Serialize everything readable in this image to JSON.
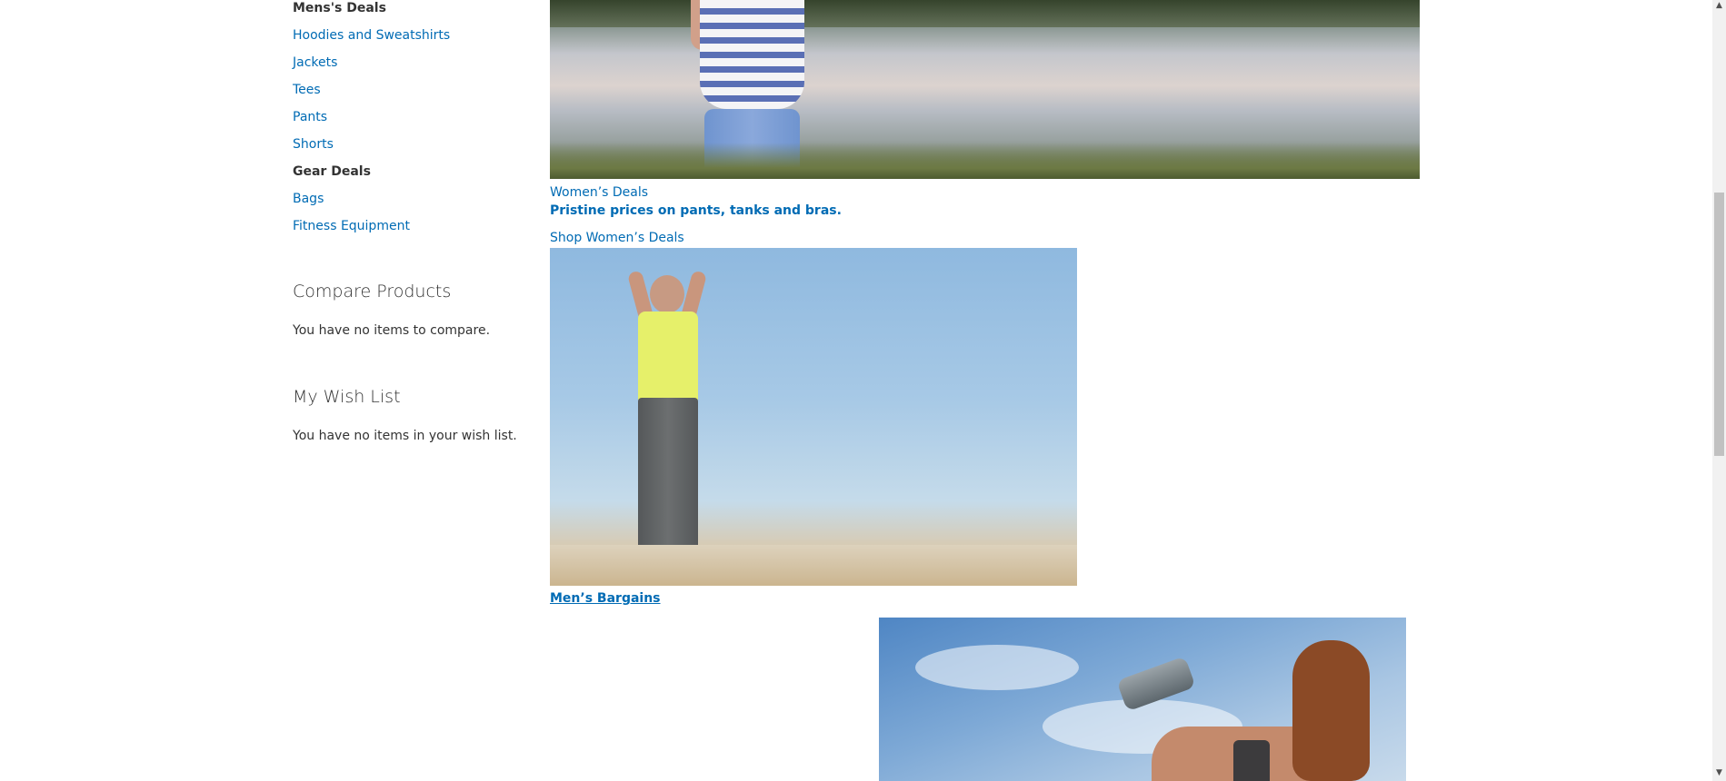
{
  "sidebar": {
    "mens_heading": "Mens's Deals",
    "mens_links": [
      "Hoodies and Sweatshirts",
      "Jackets",
      "Tees",
      "Pants",
      "Shorts"
    ],
    "gear_heading": "Gear Deals",
    "gear_links": [
      "Bags",
      "Fitness Equipment"
    ],
    "compare": {
      "title": "Compare Products",
      "empty_text": "You have no items to compare."
    },
    "wishlist": {
      "title": "My Wish List",
      "empty_text": "You have no items in your wish list."
    }
  },
  "main": {
    "womens_deals_link": "Women’s Deals",
    "promo_text": "Pristine prices on pants, tanks and bras.",
    "shop_womens_link": "Shop Women’s Deals",
    "mens_bargains_link": "Men’s Bargains"
  },
  "scrollbar": {
    "up_icon": "▲",
    "down_icon": "▼"
  }
}
